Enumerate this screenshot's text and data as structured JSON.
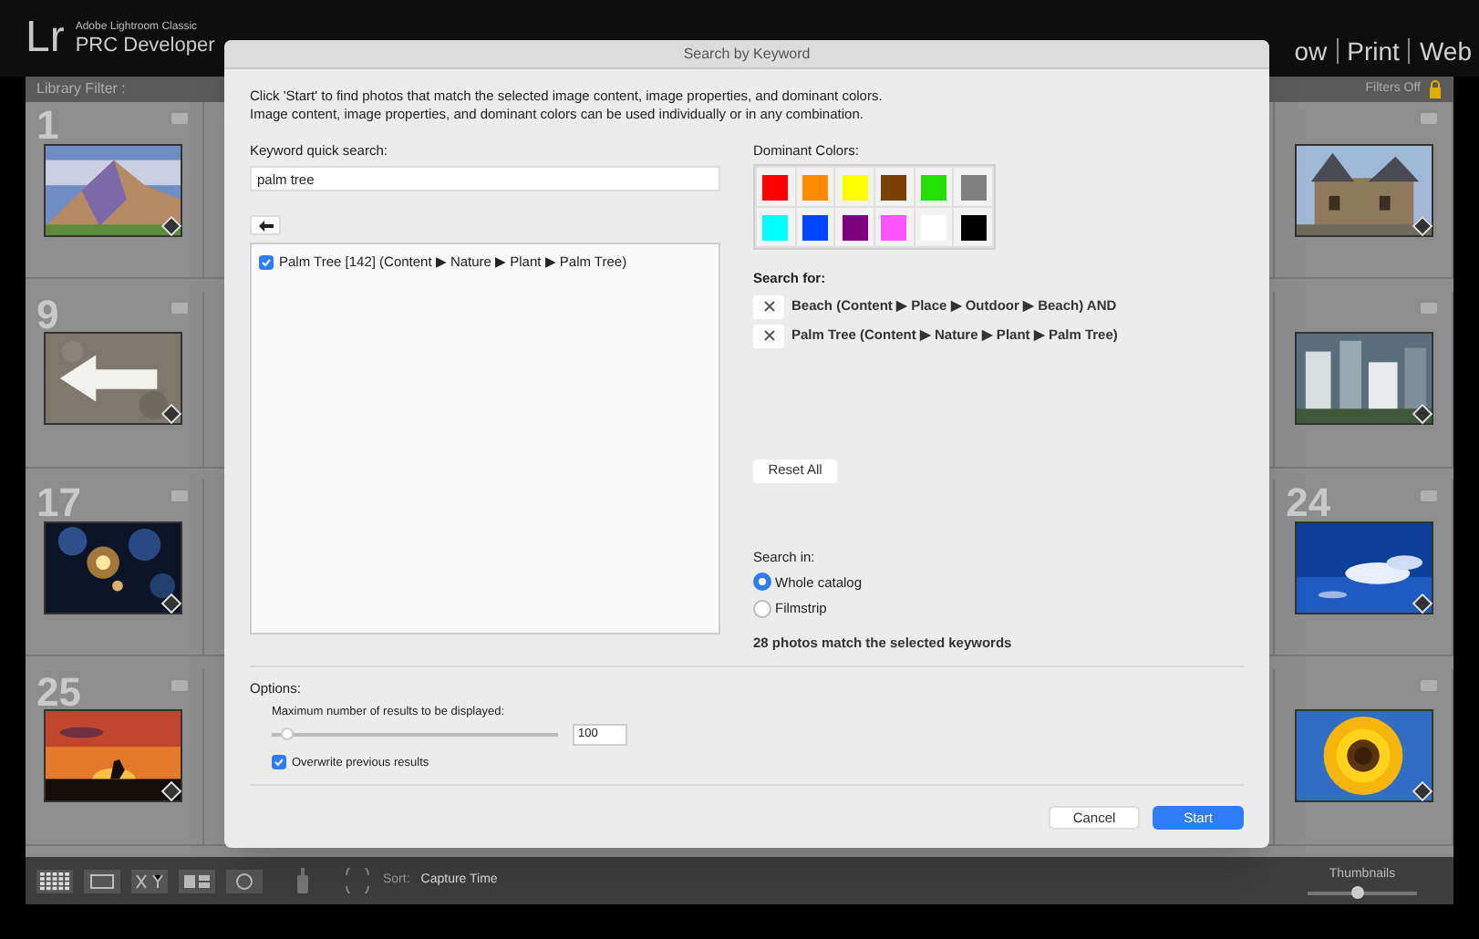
{
  "app": {
    "logo": "Lr",
    "product": "Adobe Lightroom Classic",
    "identity": "PRC Developer",
    "modules": [
      {
        "label": "ow"
      },
      {
        "label": "Print"
      },
      {
        "label": "Web"
      }
    ]
  },
  "filter_bar": {
    "label": "Library Filter :",
    "status": "Filters Off"
  },
  "grid": {
    "left": [
      {
        "number": "1",
        "kind": "picture"
      },
      {
        "number": "9",
        "kind": "picture"
      },
      {
        "number": "17",
        "kind": "picture"
      },
      {
        "number": "25",
        "kind": "picture"
      }
    ],
    "right": [
      {
        "kind": "picture"
      },
      {
        "kind": "picture"
      },
      {
        "number": "24",
        "kind": "picture"
      },
      {
        "kind": "picture"
      }
    ]
  },
  "dialog": {
    "title": "Search by Keyword",
    "intro": [
      "Click 'Start' to find photos that match the selected image content, image properties, and dominant colors.",
      "Image content, image properties, and dominant colors can be used individually or in any combination."
    ],
    "keyword_search": {
      "label": "Keyword quick search:",
      "value": "palm tree"
    },
    "keywords": [
      {
        "label": "Palm Tree [142] (Content ▶ Nature ▶ Plant ▶ Palm Tree)",
        "checked": true
      }
    ],
    "dominant_colors": {
      "label": "Dominant Colors:",
      "swatches": [
        {
          "color": "#ff0000"
        },
        {
          "color": "#ff8c00"
        },
        {
          "color": "#ffff00"
        },
        {
          "color": "#7a3f00"
        },
        {
          "color": "#22e000"
        },
        {
          "color": "#808080"
        },
        {
          "color": "#00ffff"
        },
        {
          "color": "#0044ff"
        },
        {
          "color": "#7a0080"
        },
        {
          "color": "#ff55ff"
        },
        {
          "color": "#ffffff"
        },
        {
          "color": "#000000"
        }
      ]
    },
    "search_for": {
      "label": "Search for:",
      "items": [
        {
          "text": "Beach (Content ▶ Place ▶ Outdoor ▶ Beach) AND"
        },
        {
          "text": "Palm Tree (Content ▶ Nature ▶ Plant ▶ Palm Tree)"
        }
      ]
    },
    "reset": "Reset All",
    "search_in": {
      "label": "Search in:",
      "options": [
        {
          "label": "Whole catalog",
          "selected": true
        },
        {
          "label": "Filmstrip",
          "selected": false
        }
      ]
    },
    "match_count": "28 photos match the selected keywords",
    "options": {
      "label": "Options:",
      "max_label": "Maximum number of results to be displayed:",
      "max_slider": {
        "level": 0.03
      },
      "max_value": "100",
      "overwrite": {
        "label": "Overwrite previous results",
        "checked": true
      }
    },
    "buttons": [
      {
        "label": "Cancel",
        "kind": "secondary"
      },
      {
        "label": "Start",
        "kind": "primary"
      }
    ]
  },
  "toolbar": {
    "sort_label": "Sort:",
    "sort_value": "Capture Time",
    "thumbnails_label": "Thumbnails",
    "thumbnail_size": {
      "level": 0.45
    }
  }
}
